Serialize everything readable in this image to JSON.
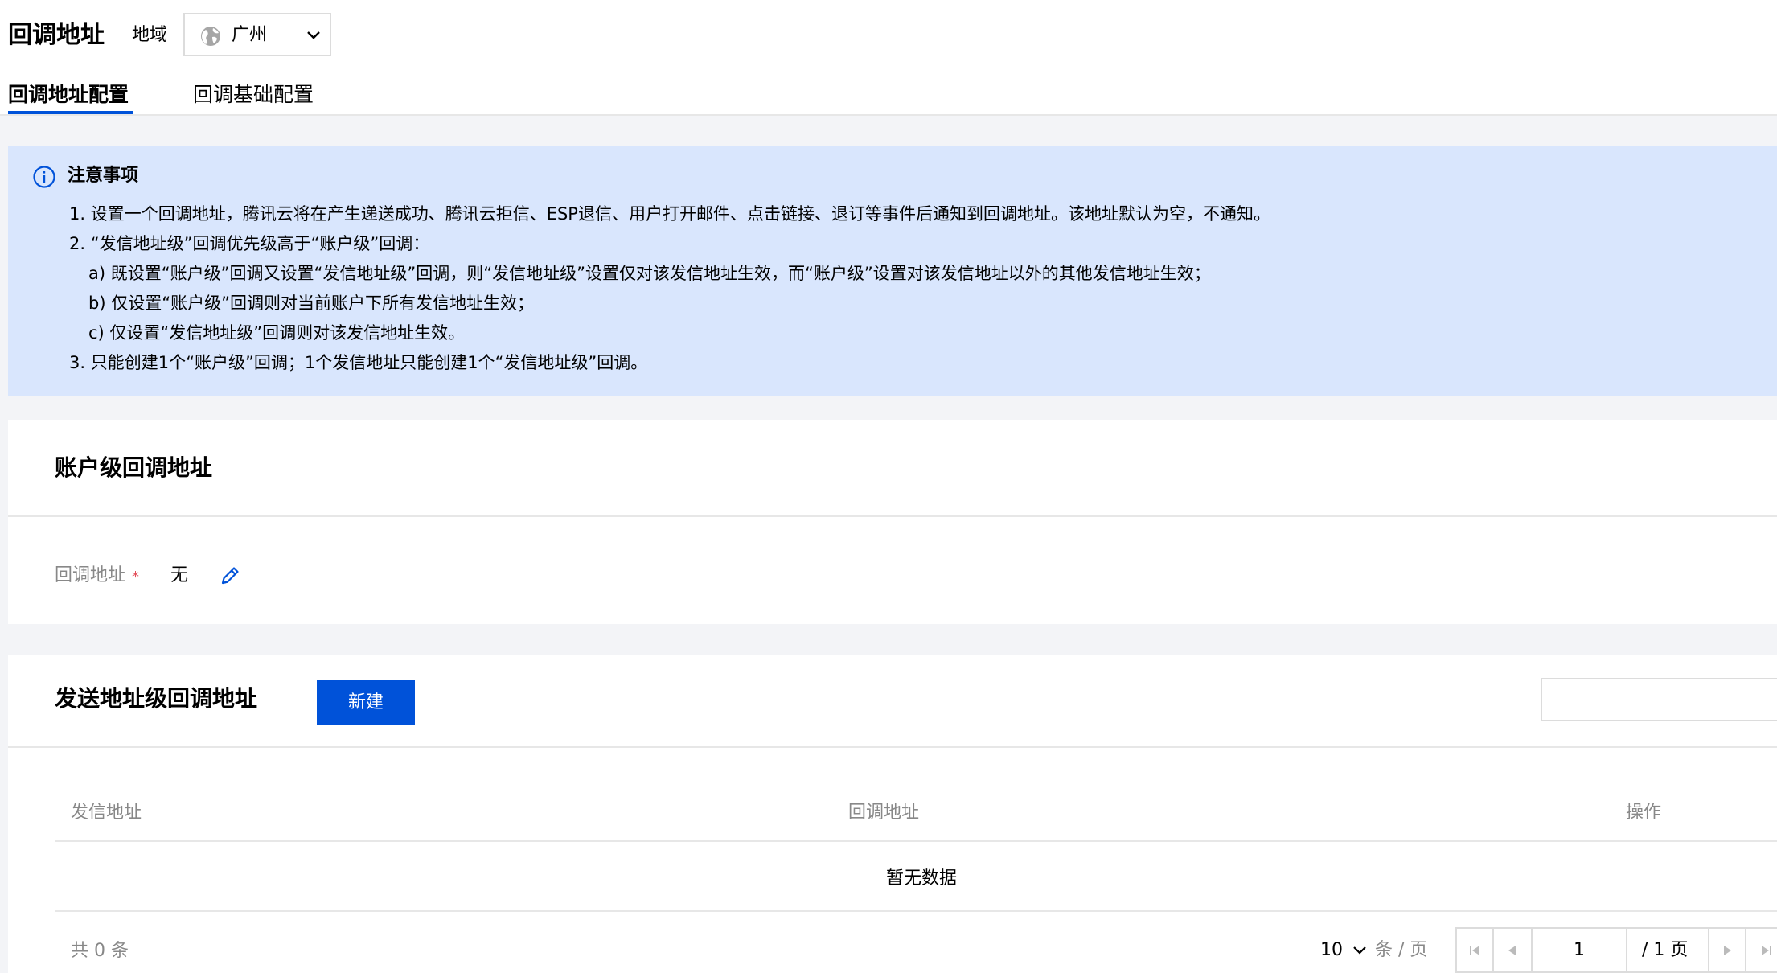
{
  "header": {
    "title": "回调地址",
    "region_label": "地域",
    "region_value": "广州"
  },
  "tabs": [
    {
      "label": "回调地址配置",
      "active": true
    },
    {
      "label": "回调基础配置",
      "active": false
    }
  ],
  "notice": {
    "title": "注意事项",
    "lines": [
      "1. 设置一个回调地址，腾讯云将在产生递送成功、腾讯云拒信、ESP退信、用户打开邮件、点击链接、退订等事件后通知到回调地址。该地址默认为空，不通知。",
      "2. “发信地址级”回调优先级高于“账户级”回调：",
      "a) 既设置“账户级”回调又设置“发信地址级”回调，则“发信地址级”设置仅对该发信地址生效，而“账户级”设置对该发信地址以外的其他发信地址生效；",
      "b) 仅设置“账户级”回调则对当前账户下所有发信地址生效；",
      "c) 仅设置“发信地址级”回调则对该发信地址生效。",
      "3. 只能创建1个“账户级”回调；1个发信地址只能创建1个“发信地址级”回调。"
    ]
  },
  "account_section": {
    "title": "账户级回调地址",
    "field_label": "回调地址",
    "required_mark": "*",
    "value": "无"
  },
  "sender_section": {
    "title": "发送地址级回调地址",
    "new_button": "新建",
    "columns": [
      "发信地址",
      "回调地址",
      "操作"
    ],
    "empty_text": "暂无数据",
    "total": "共 0 条",
    "page_size": "10",
    "per_page_label": "条 / 页",
    "current_page": "1",
    "total_pages": "/ 1 页"
  },
  "colors": {
    "primary": "#0052d9",
    "notice_bg": "#d9e6fd",
    "required": "#e34d59"
  }
}
